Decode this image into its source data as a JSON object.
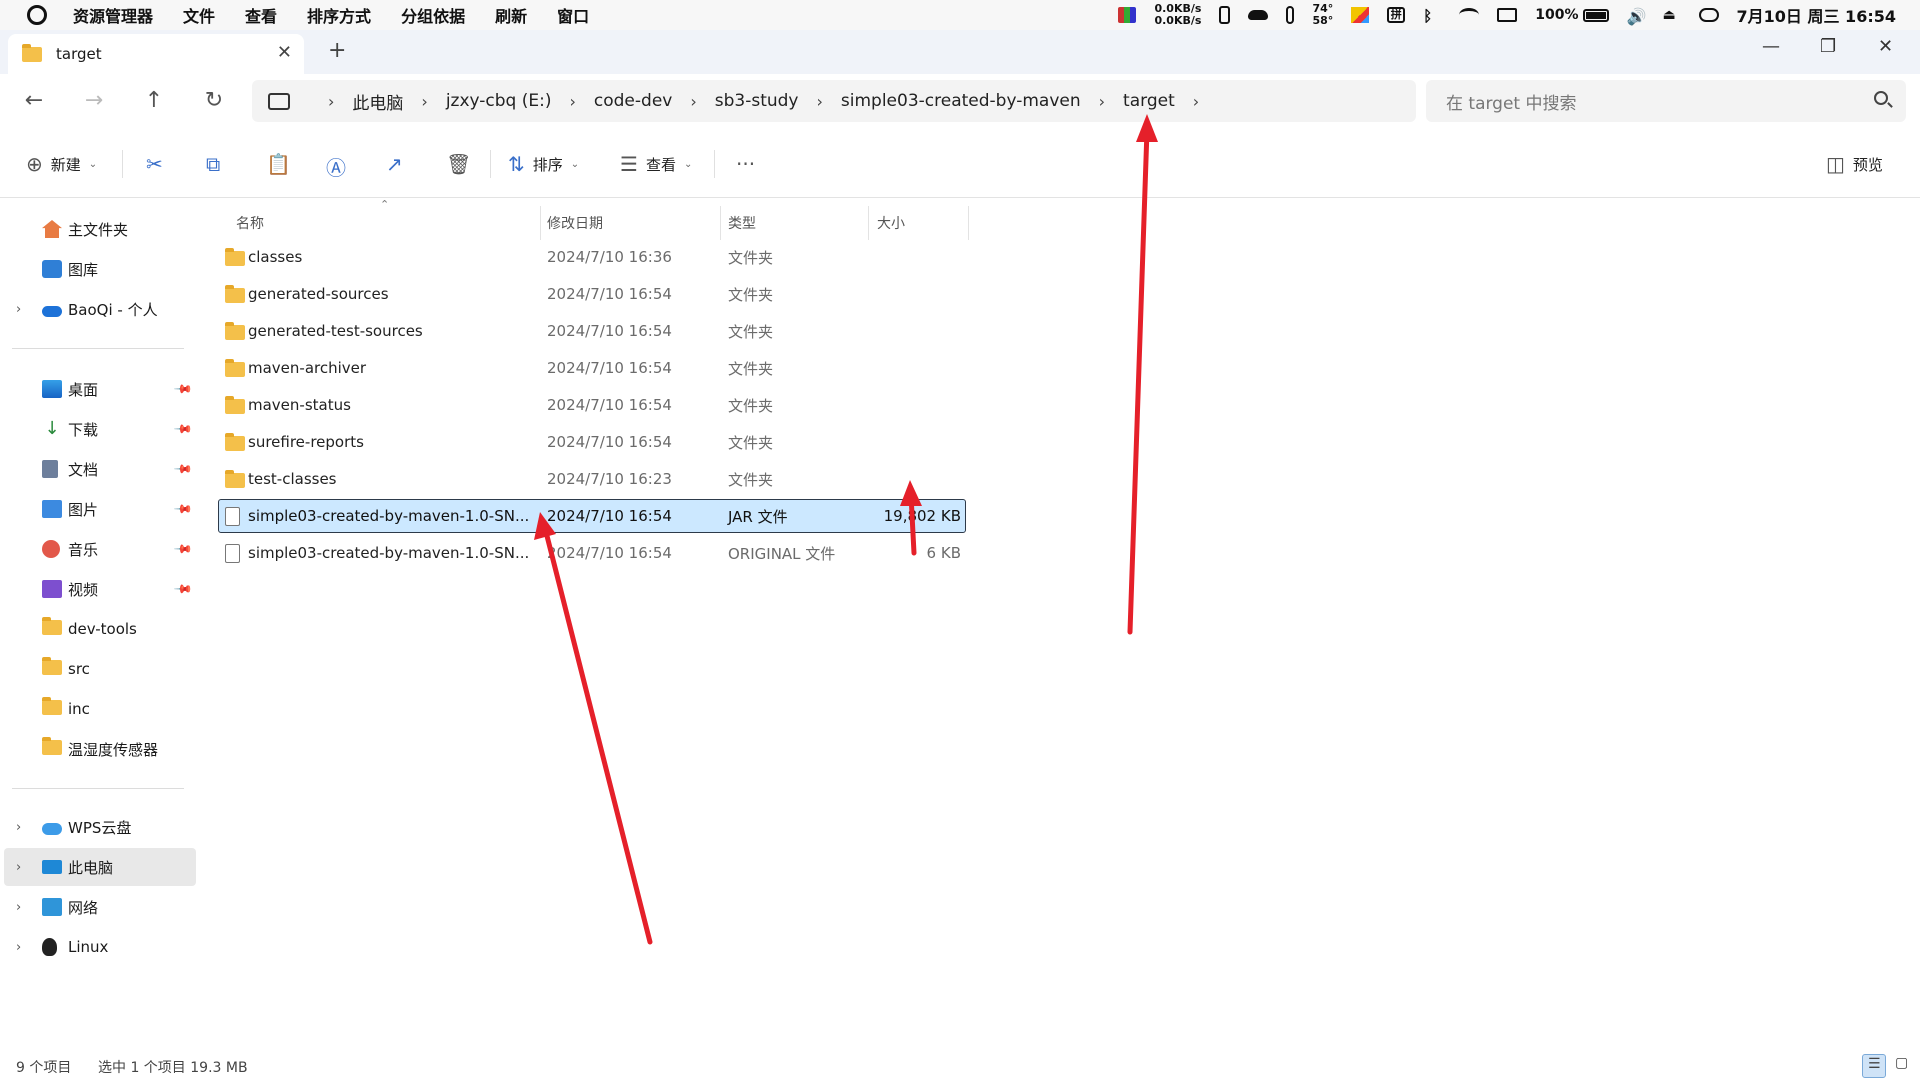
{
  "topbar": {
    "menus": [
      "资源管理器",
      "文件",
      "查看",
      "排序方式",
      "分组依据",
      "刷新",
      "窗口"
    ],
    "net_up": "0.0KB/s",
    "net_down": "0.0KB/s",
    "temp_hi": "74°",
    "temp_lo": "58°",
    "kbd_label": "拼",
    "battery": "100%",
    "clock": "7月10日 周三 16:54"
  },
  "tab": {
    "title": "target"
  },
  "address": {
    "crumbs": [
      "此电脑",
      "jzxy-cbq (E:)",
      "code-dev",
      "sb3-study",
      "simple03-created-by-maven",
      "target"
    ],
    "search_placeholder": "在 target 中搜索"
  },
  "toolbar": {
    "new_label": "新建",
    "sort_label": "排序",
    "view_label": "查看",
    "preview_label": "预览"
  },
  "sidebar": {
    "top": [
      {
        "label": "主文件夹",
        "icon": "home-icon"
      },
      {
        "label": "图库",
        "icon": "gallery-icon"
      },
      {
        "label": "BaoQi - 个人",
        "icon": "onedrive-icon"
      }
    ],
    "quick": [
      {
        "label": "桌面",
        "icon": "desktop-icon",
        "pinned": true
      },
      {
        "label": "下载",
        "icon": "download-icon",
        "pinned": true
      },
      {
        "label": "文档",
        "icon": "documents-icon",
        "pinned": true
      },
      {
        "label": "图片",
        "icon": "pictures-icon",
        "pinned": true
      },
      {
        "label": "音乐",
        "icon": "music-icon",
        "pinned": true
      },
      {
        "label": "视频",
        "icon": "videos-icon",
        "pinned": true
      },
      {
        "label": "dev-tools",
        "icon": "folder-icon",
        "pinned": false
      },
      {
        "label": "src",
        "icon": "folder-icon",
        "pinned": false
      },
      {
        "label": "inc",
        "icon": "folder-icon",
        "pinned": false
      },
      {
        "label": "温湿度传感器",
        "icon": "folder-icon",
        "pinned": false
      }
    ],
    "bottom": [
      {
        "label": "WPS云盘",
        "icon": "wps-cloud-icon"
      },
      {
        "label": "此电脑",
        "icon": "this-pc-icon",
        "selected": true
      },
      {
        "label": "网络",
        "icon": "network-icon"
      },
      {
        "label": "Linux",
        "icon": "linux-icon"
      }
    ]
  },
  "columns": {
    "name": "名称",
    "date": "修改日期",
    "type": "类型",
    "size": "大小"
  },
  "files": [
    {
      "name": "classes",
      "date": "2024/7/10 16:36",
      "type": "文件夹",
      "size": "",
      "kind": "folder"
    },
    {
      "name": "generated-sources",
      "date": "2024/7/10 16:54",
      "type": "文件夹",
      "size": "",
      "kind": "folder"
    },
    {
      "name": "generated-test-sources",
      "date": "2024/7/10 16:54",
      "type": "文件夹",
      "size": "",
      "kind": "folder"
    },
    {
      "name": "maven-archiver",
      "date": "2024/7/10 16:54",
      "type": "文件夹",
      "size": "",
      "kind": "folder"
    },
    {
      "name": "maven-status",
      "date": "2024/7/10 16:54",
      "type": "文件夹",
      "size": "",
      "kind": "folder"
    },
    {
      "name": "surefire-reports",
      "date": "2024/7/10 16:54",
      "type": "文件夹",
      "size": "",
      "kind": "folder"
    },
    {
      "name": "test-classes",
      "date": "2024/7/10 16:23",
      "type": "文件夹",
      "size": "",
      "kind": "folder"
    },
    {
      "name": "simple03-created-by-maven-1.0-SN...",
      "date": "2024/7/10 16:54",
      "type": "JAR 文件",
      "size": "19,802 KB",
      "kind": "file",
      "selected": true
    },
    {
      "name": "simple03-created-by-maven-1.0-SN...",
      "date": "2024/7/10 16:54",
      "type": "ORIGINAL 文件",
      "size": "6 KB",
      "kind": "file"
    }
  ],
  "status": {
    "count": "9 个项目",
    "selection": "选中 1 个项目  19.3 MB"
  },
  "colors": {
    "accent": "#0067c0",
    "selection": "#cce8ff",
    "folder": "#f4c04a",
    "annotation": "#e5202a"
  }
}
